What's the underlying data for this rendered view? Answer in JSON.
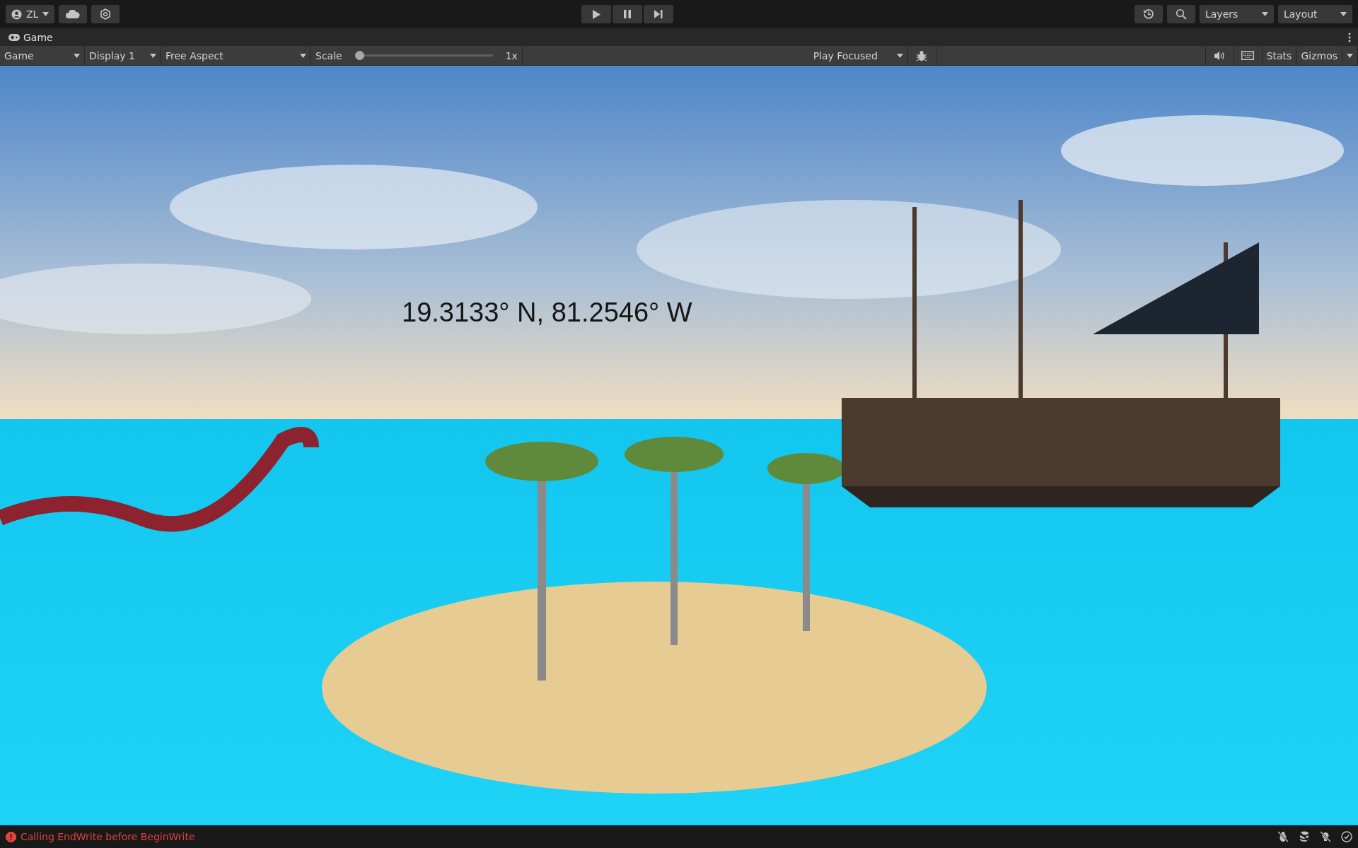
{
  "toolbar": {
    "account": "ZL",
    "layers": "Layers",
    "layout": "Layout"
  },
  "tab": {
    "label": "Game",
    "selected": true
  },
  "game_toolbar": {
    "view": "Game",
    "display": "Display 1",
    "aspect": "Free Aspect",
    "scale_label": "Scale",
    "scale": {
      "level": 0
    },
    "scale_value": "1x",
    "play_mode": "Play Focused",
    "stats": "Stats",
    "gizmos": "Gizmos"
  },
  "game_view": {
    "overlay_text": "19.3133° N, 81.2546° W"
  },
  "status_bar": {
    "message": "Calling EndWrite before BeginWrite",
    "kind": "error"
  }
}
